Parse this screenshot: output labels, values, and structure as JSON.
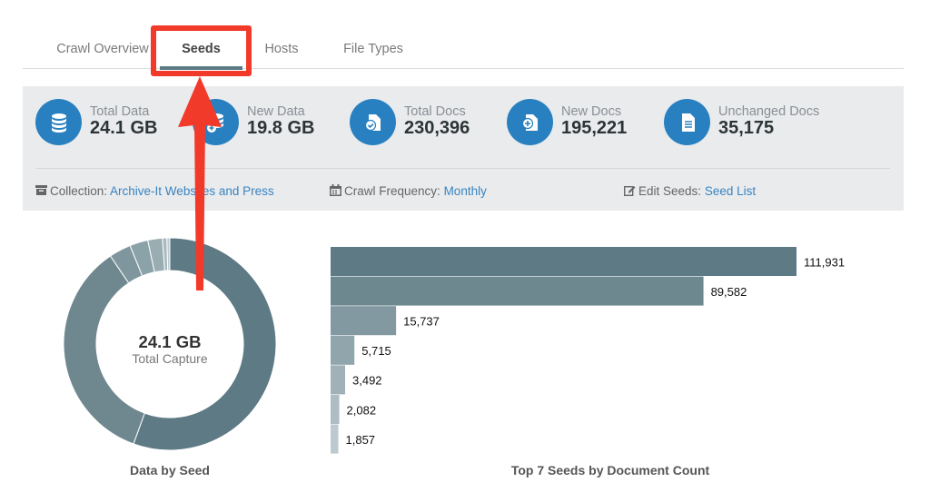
{
  "tabs": [
    {
      "label": "Crawl Overview",
      "active": false
    },
    {
      "label": "Seeds",
      "active": true
    },
    {
      "label": "Hosts",
      "active": false
    },
    {
      "label": "File Types",
      "active": false
    }
  ],
  "stats": [
    {
      "label": "Total Data",
      "value": "24.1 GB",
      "icon": "database-icon"
    },
    {
      "label": "New Data",
      "value": "19.8 GB",
      "icon": "database-plus-icon"
    },
    {
      "label": "Total Docs",
      "value": "230,396",
      "icon": "document-check-icon"
    },
    {
      "label": "New Docs",
      "value": "195,221",
      "icon": "document-plus-icon"
    },
    {
      "label": "Unchanged Docs",
      "value": "35,175",
      "icon": "document-lines-icon"
    }
  ],
  "meta": {
    "collection_label": "Collection:",
    "collection_value": "Archive-It Websites and Press",
    "frequency_label": "Crawl Frequency:",
    "frequency_value": "Monthly",
    "edit_label": "Edit Seeds:",
    "edit_value": "Seed List"
  },
  "donut": {
    "center_value": "24.1 GB",
    "center_label": "Total Capture",
    "caption": "Data by Seed"
  },
  "bar_chart": {
    "caption": "Top 7 Seeds by Document Count"
  },
  "chart_data": [
    {
      "type": "pie",
      "title": "Data by Seed",
      "values": [
        0.5,
        0.315,
        0.03,
        0.025,
        0.02,
        0.006,
        0.004
      ],
      "colors": [
        "#5d7a85",
        "#6f8890",
        "#7f969e",
        "#8ca2a9",
        "#99adb3",
        "#a9babf",
        "#bccbcf"
      ]
    },
    {
      "type": "bar",
      "title": "Top 7 Seeds by Document Count",
      "values": [
        111931,
        89582,
        15737,
        5715,
        3492,
        2082,
        1857
      ],
      "labels": [
        "111,931",
        "89,582",
        "15,737",
        "5,715",
        "3,492",
        "2,082",
        "1,857"
      ],
      "colors": [
        "#5d7a85",
        "#6e8890",
        "#8299a1",
        "#91a5ad",
        "#a0b1b8",
        "#adbdc3",
        "#bcc9ce"
      ]
    }
  ],
  "colors": {
    "accent": "#2980c0",
    "highlight": "#f23a2b",
    "panel": "#e9ebed"
  }
}
